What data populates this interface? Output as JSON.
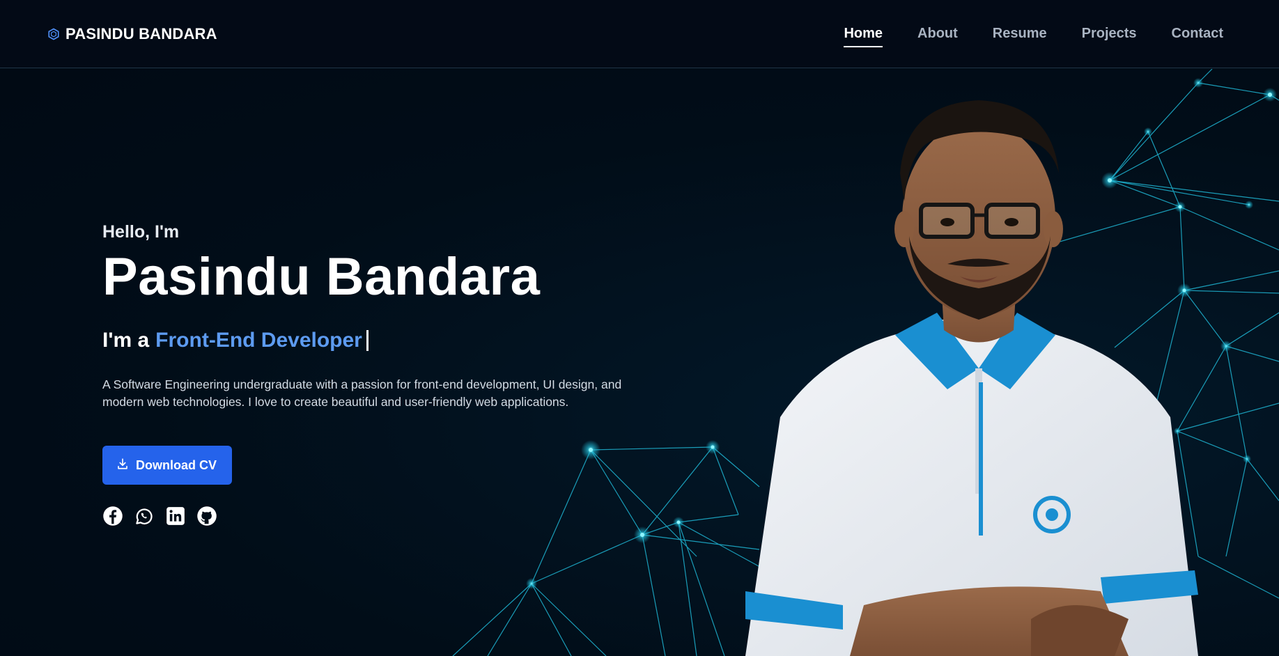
{
  "brand": {
    "name": "PASINDU BANDARA",
    "icon": "hexagon-logo-icon"
  },
  "nav": {
    "items": [
      {
        "label": "Home",
        "active": true
      },
      {
        "label": "About",
        "active": false
      },
      {
        "label": "Resume",
        "active": false
      },
      {
        "label": "Projects",
        "active": false
      },
      {
        "label": "Contact",
        "active": false
      }
    ]
  },
  "hero": {
    "greeting": "Hello, I'm",
    "name": "Pasindu Bandara",
    "role_prefix": "I'm a",
    "role": "Front-End Developer",
    "description": "A Software Engineering undergraduate with a passion for front-end development, UI design, and modern web technologies. I love to create beautiful and user-friendly web applications.",
    "download_label": "Download CV"
  },
  "socials": [
    {
      "name": "facebook-icon"
    },
    {
      "name": "whatsapp-icon"
    },
    {
      "name": "linkedin-icon"
    },
    {
      "name": "github-icon"
    }
  ],
  "colors": {
    "background": "#010d18",
    "nav_background": "#030a16",
    "accent": "#5d9bf0",
    "button": "#2563eb",
    "network": "#22c4e0"
  }
}
